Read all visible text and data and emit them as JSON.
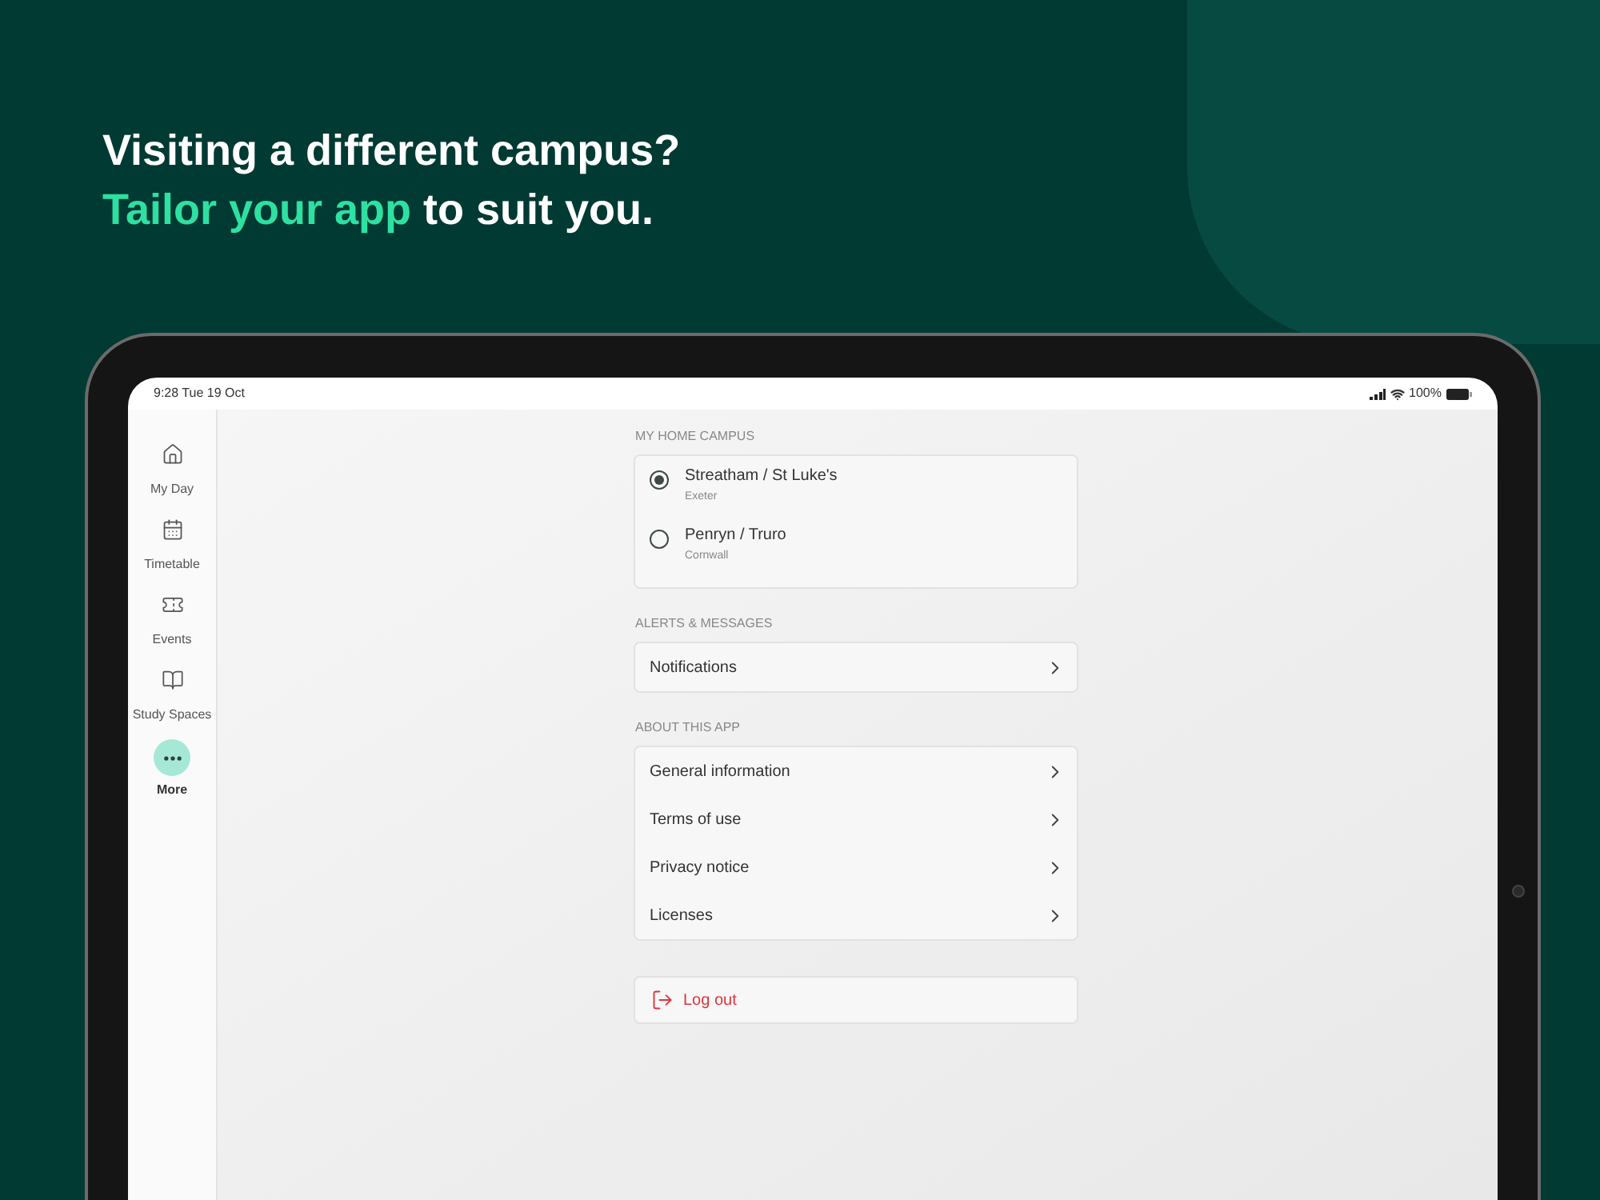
{
  "headline": {
    "line_1": "Visiting a different campus?",
    "highlight": "Tailor your app",
    "rest": "to suit you."
  },
  "status_bar": {
    "time": "9:28",
    "date": "Tue 19 Oct",
    "battery": "100%"
  },
  "sidebar": {
    "items": [
      {
        "label": "My Day",
        "selected": false
      },
      {
        "label": "Timetable",
        "selected": false
      },
      {
        "label": "Events",
        "selected": false
      },
      {
        "label": "Study Spaces",
        "selected": false
      },
      {
        "label": "More",
        "selected": true
      }
    ]
  },
  "sections": [
    {
      "kind": "radio",
      "heading": "MY HOME CAMPUS",
      "options": [
        {
          "label": "Streatham / St Luke's",
          "sublabel": "Exeter",
          "selected": true
        },
        {
          "label": "Penryn / Truro",
          "sublabel": "Cornwall",
          "selected": false
        }
      ]
    },
    {
      "kind": "links",
      "heading": "ALERTS & MESSAGES",
      "items": [
        {
          "label": "Notifications"
        }
      ]
    },
    {
      "kind": "links",
      "heading": "ABOUT THIS APP",
      "items": [
        {
          "label": "General information"
        },
        {
          "label": "Terms of use"
        },
        {
          "label": "Privacy notice"
        },
        {
          "label": "Licenses"
        }
      ]
    },
    {
      "kind": "logout",
      "label": "Log out"
    }
  ]
}
